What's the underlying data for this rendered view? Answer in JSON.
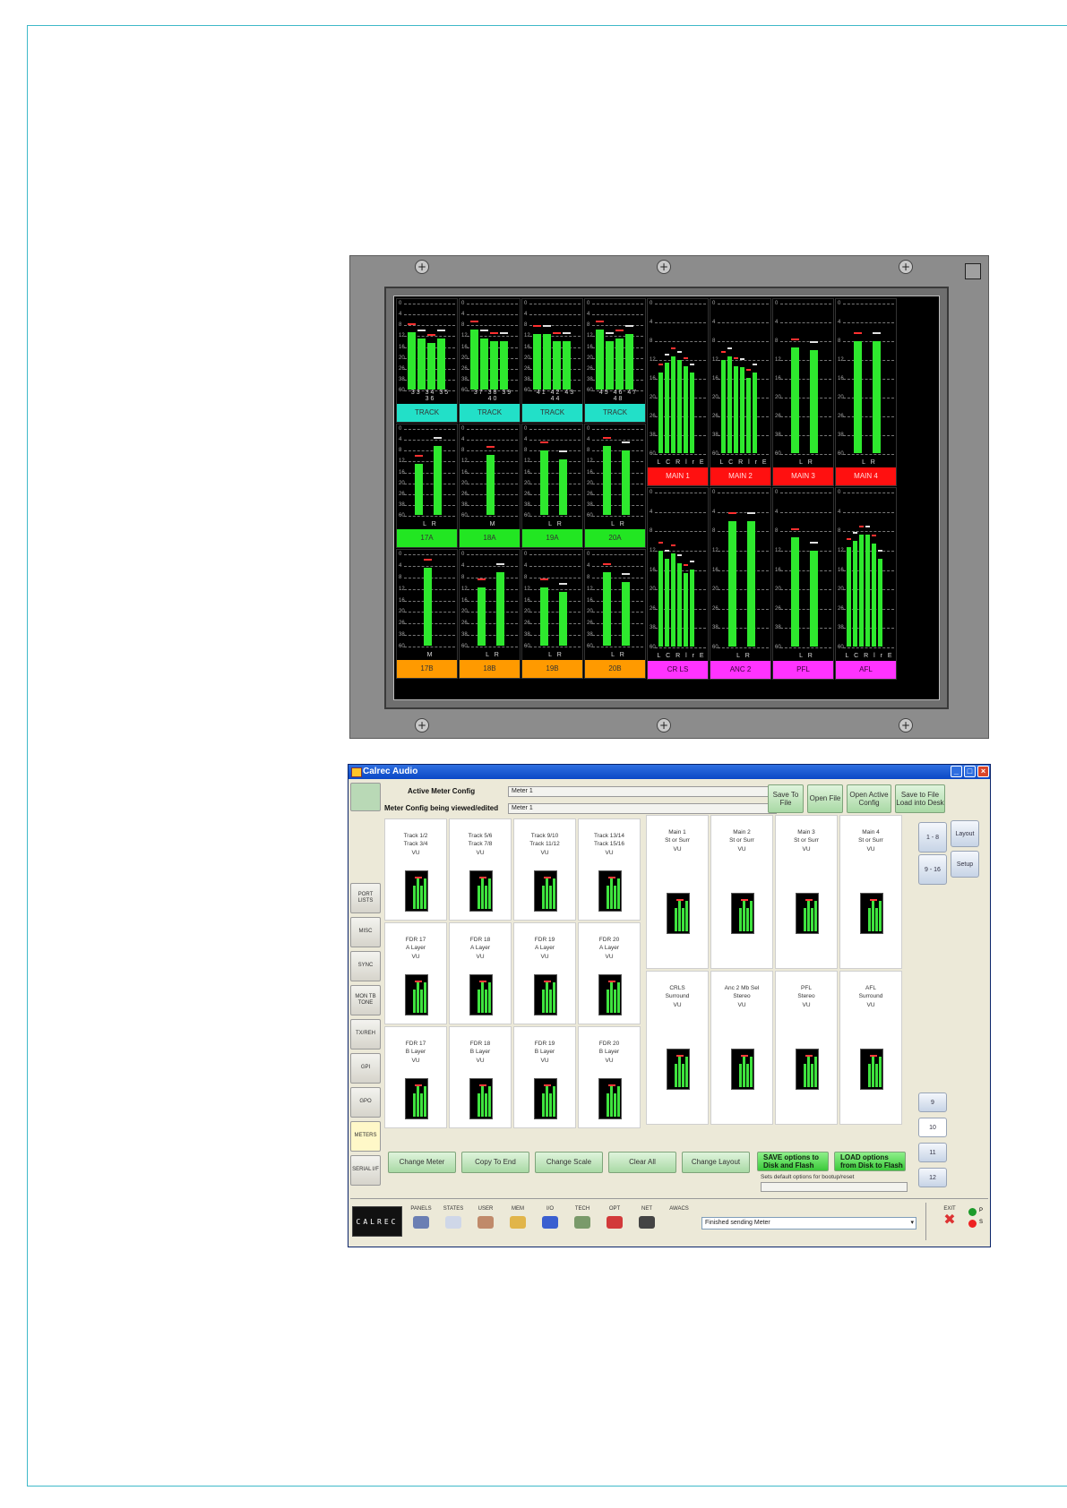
{
  "meter_panel": {
    "scale_marks": [
      "0",
      "4",
      "8",
      "12",
      "16",
      "20",
      "26",
      "38",
      "60"
    ],
    "track_meters": [
      {
        "numbers": "33 34 35 36",
        "label": "TRACK"
      },
      {
        "numbers": "37 38 39 40",
        "label": "TRACK"
      },
      {
        "numbers": "41 42 43 44",
        "label": "TRACK"
      },
      {
        "numbers": "45 46 47 48",
        "label": "TRACK"
      }
    ],
    "main_meters": [
      {
        "channels": "L C R l r E",
        "label": "MAIN 1"
      },
      {
        "channels": "L C R l r E",
        "label": "MAIN 2"
      },
      {
        "channels": "L  R",
        "label": "MAIN 3"
      },
      {
        "channels": "L  R",
        "label": "MAIN 4"
      }
    ],
    "fdr_a_meters": [
      {
        "channels": "L  R",
        "label": "17A"
      },
      {
        "channels": "M",
        "label": "18A"
      },
      {
        "channels": "L  R",
        "label": "19A"
      },
      {
        "channels": "L  R",
        "label": "20A"
      }
    ],
    "fdr_b_meters": [
      {
        "channels": "M",
        "label": "17B"
      },
      {
        "channels": "L  R",
        "label": "18B"
      },
      {
        "channels": "L  R",
        "label": "19B"
      },
      {
        "channels": "L  R",
        "label": "20B"
      }
    ],
    "bottom_right_meters": [
      {
        "channels": "L C R l r E",
        "label": "CR LS"
      },
      {
        "channels": "L  R",
        "label": "ANC 2"
      },
      {
        "channels": "L  R",
        "label": "PFL"
      },
      {
        "channels": "L C R l r E",
        "label": "AFL"
      }
    ],
    "colors": {
      "track": "#22e0c8",
      "main": "#ff1010",
      "fdr_a": "#22e622",
      "fdr_b": "#ff9a00",
      "monitor": "#ff33ff",
      "bar": "#2ee82e"
    }
  },
  "app": {
    "title": "Calrec Audio",
    "active_config_label": "Active Meter Config",
    "active_config_value": "Meter 1",
    "viewed_config_label": "Meter Config being viewed/edited",
    "viewed_config_value": "Meter 1",
    "top_buttons": [
      "Save To File",
      "Open File",
      "Open Active Config",
      "Save to File Load into Desk"
    ],
    "nav_items": [
      "PORT LISTS",
      "MISC",
      "SYNC",
      "MON TB TONE",
      "TX/REH",
      "GPI",
      "GPO",
      "METERS",
      "SERIAL I/F"
    ],
    "side_buttons": [
      "1 - 8",
      "9 - 16",
      "Layout",
      "Setup"
    ],
    "page_buttons": [
      "9",
      "10",
      "11",
      "12"
    ],
    "cells_left": [
      [
        "Track 1/2",
        "Track 3/4",
        "VU"
      ],
      [
        "Track 5/6",
        "Track 7/8",
        "VU"
      ],
      [
        "Track 9/10",
        "Track 11/12",
        "VU"
      ],
      [
        "Track 13/14",
        "Track 15/16",
        "VU"
      ],
      [
        "FDR 17",
        "A Layer",
        "VU"
      ],
      [
        "FDR 18",
        "A Layer",
        "VU"
      ],
      [
        "FDR 19",
        "A Layer",
        "VU"
      ],
      [
        "FDR 20",
        "A Layer",
        "VU"
      ],
      [
        "FDR 17",
        "B Layer",
        "VU"
      ],
      [
        "FDR 18",
        "B Layer",
        "VU"
      ],
      [
        "FDR 19",
        "B Layer",
        "VU"
      ],
      [
        "FDR 20",
        "B Layer",
        "VU"
      ]
    ],
    "cells_right": [
      [
        "Main 1",
        "St or Surr",
        "VU"
      ],
      [
        "Main 2",
        "St or Surr",
        "VU"
      ],
      [
        "Main 3",
        "St or Surr",
        "VU"
      ],
      [
        "Main 4",
        "St or Surr",
        "VU"
      ],
      [
        "CRLS",
        "Surround",
        "VU"
      ],
      [
        "Anc 2 Mb Sel",
        "Stereo",
        "VU"
      ],
      [
        "PFL",
        "Stereo",
        "VU"
      ],
      [
        "AFL",
        "Surround",
        "VU"
      ]
    ],
    "bottom_buttons": [
      "Change Meter",
      "Copy To End",
      "Change Scale",
      "Clear All",
      "Change Layout"
    ],
    "save_options": "SAVE options to Disk and Flash",
    "load_options": "LOAD options from Disk to Flash",
    "options_hint": "Sets default options for bootup/reset",
    "status": {
      "logo": "CALREC",
      "tools": [
        "PANELS",
        "STATES",
        "USER",
        "MEM",
        "I/O",
        "TECH",
        "OPT",
        "NET",
        "AWACS"
      ],
      "message": "Finished sending Meter",
      "exit": "EXIT",
      "ps": [
        "P",
        "S"
      ]
    }
  }
}
